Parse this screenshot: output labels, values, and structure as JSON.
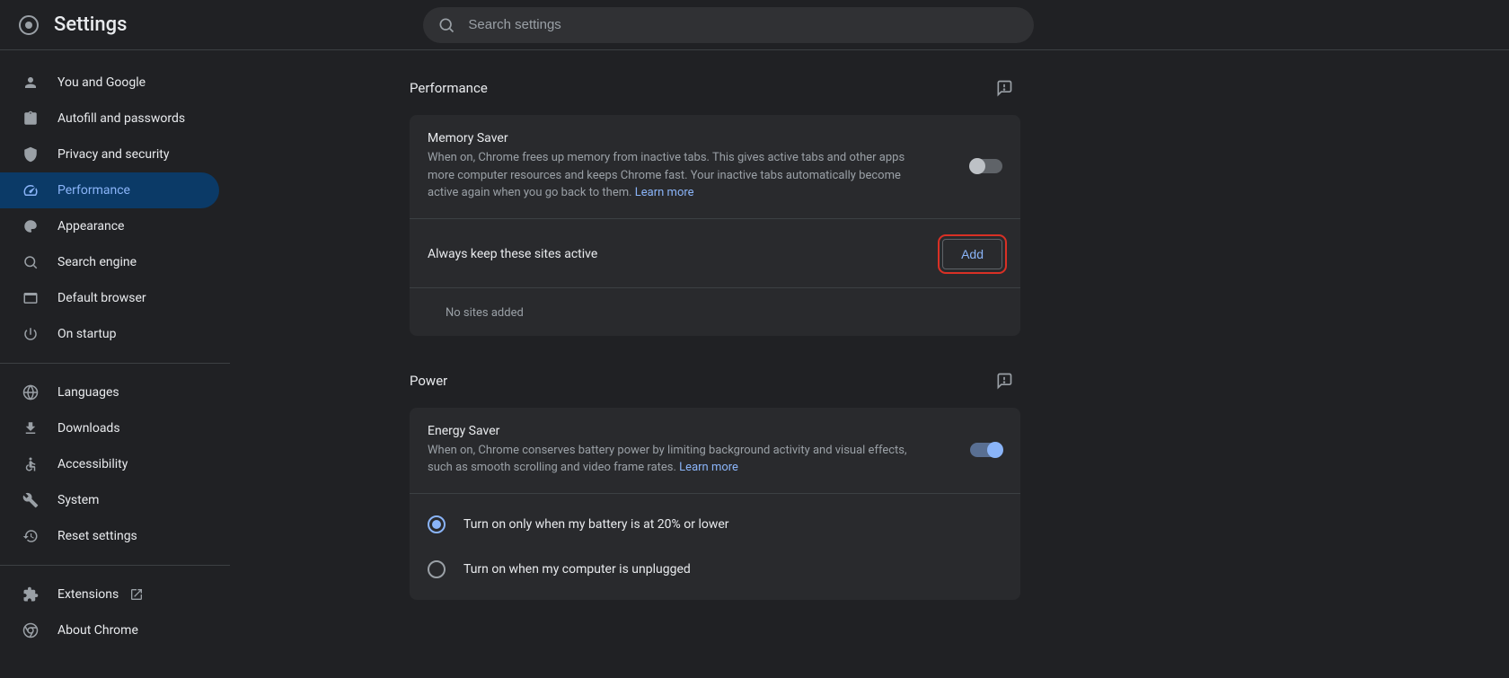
{
  "header": {
    "title": "Settings"
  },
  "search": {
    "placeholder": "Search settings"
  },
  "sidebar": {
    "groups": [
      [
        {
          "icon": "person",
          "label": "You and Google"
        },
        {
          "icon": "clipboard",
          "label": "Autofill and passwords"
        },
        {
          "icon": "shield",
          "label": "Privacy and security"
        },
        {
          "icon": "speed",
          "label": "Performance",
          "active": true
        },
        {
          "icon": "palette",
          "label": "Appearance"
        },
        {
          "icon": "search",
          "label": "Search engine"
        },
        {
          "icon": "browser",
          "label": "Default browser"
        },
        {
          "icon": "power",
          "label": "On startup"
        }
      ],
      [
        {
          "icon": "globe",
          "label": "Languages"
        },
        {
          "icon": "download",
          "label": "Downloads"
        },
        {
          "icon": "accessibility",
          "label": "Accessibility"
        },
        {
          "icon": "wrench",
          "label": "System"
        },
        {
          "icon": "history",
          "label": "Reset settings"
        }
      ],
      [
        {
          "icon": "extension",
          "label": "Extensions",
          "external": true
        },
        {
          "icon": "chrome",
          "label": "About Chrome"
        }
      ]
    ]
  },
  "performance_section": {
    "title": "Performance",
    "memory_saver": {
      "title": "Memory Saver",
      "desc": "When on, Chrome frees up memory from inactive tabs. This gives active tabs and other apps more computer resources and keeps Chrome fast. Your inactive tabs automatically become active again when you go back to them.",
      "learn_more": "Learn more",
      "enabled": false
    },
    "keep_active": {
      "label": "Always keep these sites active",
      "add_label": "Add",
      "empty_text": "No sites added"
    }
  },
  "power_section": {
    "title": "Power",
    "energy_saver": {
      "title": "Energy Saver",
      "desc": "When on, Chrome conserves battery power by limiting background activity and visual effects, such as smooth scrolling and video frame rates.",
      "learn_more": "Learn more",
      "enabled": true
    },
    "radio_options": {
      "selected": 0,
      "options": [
        "Turn on only when my battery is at 20% or lower",
        "Turn on when my computer is unplugged"
      ]
    }
  }
}
